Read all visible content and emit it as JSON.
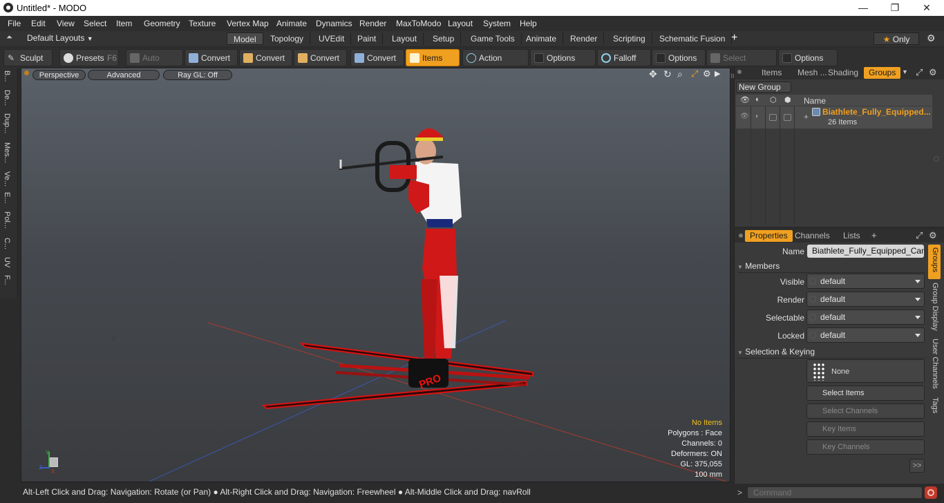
{
  "window": {
    "title": "Untitled* - MODO",
    "minimize": "—",
    "maximize": "❐",
    "close": "✕"
  },
  "menu": [
    "File",
    "Edit",
    "View",
    "Select",
    "Item",
    "Geometry",
    "Texture",
    "Vertex Map",
    "Animate",
    "Dynamics",
    "Render",
    "MaxToModo",
    "Layout",
    "System",
    "Help"
  ],
  "layouts": {
    "selector": "Default Layouts",
    "tabs": [
      "Model",
      "Topology",
      "UVEdit",
      "Paint",
      "Layout",
      "Setup",
      "Game Tools",
      "Animate",
      "Render",
      "Scripting",
      "Schematic Fusion"
    ],
    "active": "Model",
    "plus": "+",
    "only_label": "Only"
  },
  "toolbar": {
    "sculpt": "Sculpt",
    "presets": "Presets",
    "presets_key": "F6",
    "auto_select": "Auto Select",
    "convert1": "Convert",
    "convert2": "Convert",
    "convert3": "Convert",
    "convert4": "Convert",
    "items": "Items",
    "action_center": "Action Center",
    "options1": "Options",
    "falloff": "Falloff",
    "options2": "Options",
    "select_through": "Select Through",
    "options3": "Options"
  },
  "left_tabs": [
    "B...",
    "De...",
    "Dup...",
    "Mes...",
    "Ve...",
    "E...",
    "Pol...",
    "C...",
    "UV",
    "F..."
  ],
  "viewport": {
    "view_mode": "Perspective",
    "shading": "Advanced",
    "raygl": "Ray GL: Off",
    "info": {
      "selection": "No Items",
      "polygons": "Polygons : Face",
      "channels": "Channels: 0",
      "deformers": "Deformers: ON",
      "gl": "GL: 375,055",
      "scale": "100 mm"
    },
    "axis_x": "X",
    "axis_y": "Y",
    "axis_z": "Z",
    "ski_text": "PRO"
  },
  "status": "Alt-Left Click and Drag: Navigation: Rotate (or Pan) ● Alt-Right Click and Drag: Navigation: Freewheel ● Alt-Middle Click and Drag: navRoll",
  "groups_panel": {
    "tabs": [
      "Items",
      "Mesh ...",
      "Shading",
      "Groups"
    ],
    "active": "Groups",
    "new_group": "New Group",
    "col_name": "Name",
    "group_name": "Biathlete_Fully_Equipped...",
    "group_count": "26 Items",
    "expand": "+"
  },
  "properties_panel": {
    "tabs": [
      "Properties",
      "Channels",
      "Lists"
    ],
    "active": "Properties",
    "plus": "+",
    "name_label": "Name",
    "name_value": "Biathlete_Fully_Equipped_Canad",
    "members_section": "Members",
    "fields": [
      {
        "label": "Visible",
        "value": "default"
      },
      {
        "label": "Render",
        "value": "default"
      },
      {
        "label": "Selectable",
        "value": "default"
      },
      {
        "label": "Locked",
        "value": "default"
      }
    ],
    "keying_section": "Selection & Keying",
    "none_label": "None",
    "select_items": "Select Items",
    "select_channels": "Select Channels",
    "key_items": "Key Items",
    "key_channels": "Key Channels",
    "more": ">>",
    "side_tabs": [
      "Groups",
      "Group Display",
      "User Channels",
      "Tags"
    ]
  },
  "command": {
    "prompt": ">",
    "placeholder": "Command"
  },
  "colors": {
    "accent": "#f0a020",
    "viewport_top": "#5b6169",
    "viewport_bottom": "#3a3c3f"
  }
}
